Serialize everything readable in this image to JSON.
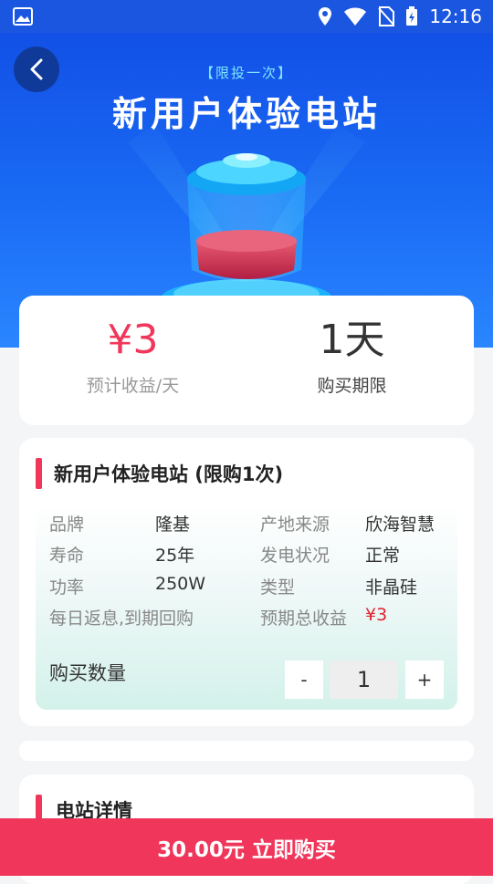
{
  "status_bar": {
    "time": "12:16"
  },
  "hero": {
    "tag": "【限投一次】",
    "title": "新用户体验电站"
  },
  "summary": {
    "income_value": "¥3",
    "income_label": "预计收益/天",
    "period_value": "1天",
    "period_label": "购买期限"
  },
  "product": {
    "title": "新用户体验电站 (限购1次)",
    "specs": [
      {
        "k1": "品牌",
        "v1": "隆基",
        "k2": "产地来源",
        "v2": "欣海智慧"
      },
      {
        "k1": "寿命",
        "v1": "25年",
        "k2": "发电状况",
        "v2": "正常"
      },
      {
        "k1": "功率",
        "v1": "250W",
        "k2": "类型",
        "v2": "非晶硅"
      },
      {
        "k1": "每日返息,到期回购",
        "v1": "",
        "k2": "预期总收益",
        "v2": "¥3"
      }
    ],
    "quantity_label": "购买数量",
    "minus": "-",
    "quantity": "1",
    "plus": "+"
  },
  "detail": {
    "title": "电站详情"
  },
  "buy_button": {
    "label": "30.00元 立即购买"
  },
  "colors": {
    "accent": "#f0365a",
    "hero_blue": "#1a6cf5",
    "price_red": "#e0232e"
  }
}
